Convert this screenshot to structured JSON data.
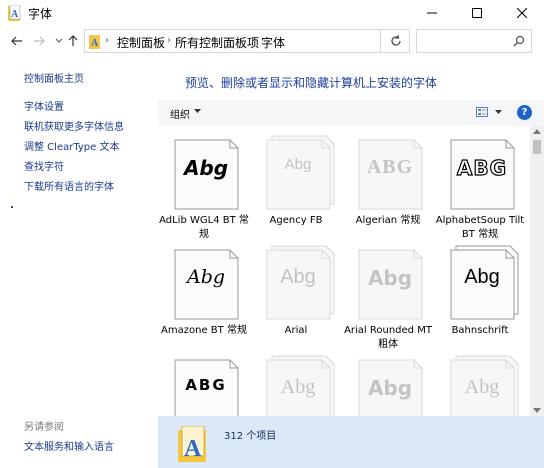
{
  "window": {
    "title": "字体",
    "controls": {
      "minimize_icon": "minimize-icon",
      "maximize_icon": "maximize-icon",
      "close_icon": "close-icon"
    }
  },
  "address_bar": {
    "breadcrumbs": [
      "控制面板",
      "所有控制面板项",
      "字体"
    ],
    "search_placeholder": ""
  },
  "left_pane": {
    "home": "控制面板主页",
    "links": [
      "字体设置",
      "联机获取更多字体信息",
      "调整 ClearType 文本",
      "查找字符",
      "下载所有语言的字体"
    ],
    "see_also_heading": "另请参阅",
    "see_also_links": [
      "文本服务和输入语言"
    ]
  },
  "main": {
    "title": "预览、删除或者显示和隐藏计算机上安装的字体",
    "toolbar": {
      "organize": "组织",
      "help": "?"
    },
    "fonts": [
      {
        "name": "AdLib WGL4 BT 常规",
        "sample": "Abg",
        "style": "bold-italic",
        "hidden": false,
        "stacked": false
      },
      {
        "name": "Agency FB",
        "sample": "Abg",
        "style": "condensed",
        "hidden": true,
        "stacked": true
      },
      {
        "name": "Algerian 常规",
        "sample": "ABG",
        "style": "serif-caps",
        "hidden": true,
        "stacked": false
      },
      {
        "name": "AlphabetSoup Tilt BT 常规",
        "sample": "ABG",
        "style": "outline-caps",
        "hidden": false,
        "stacked": false
      },
      {
        "name": "Amazone BT 常规",
        "sample": "Abg",
        "style": "script",
        "hidden": false,
        "stacked": false
      },
      {
        "name": "Arial",
        "sample": "Abg",
        "style": "sans",
        "hidden": true,
        "stacked": true
      },
      {
        "name": "Arial Rounded MT 粗体",
        "sample": "Abg",
        "style": "rounded-bold",
        "hidden": true,
        "stacked": false
      },
      {
        "name": "Bahnschrift",
        "sample": "Abg",
        "style": "sans",
        "hidden": false,
        "stacked": true
      },
      {
        "name": "",
        "sample": "ABG",
        "style": "wide-caps",
        "hidden": false,
        "stacked": false
      },
      {
        "name": "",
        "sample": "Abg",
        "style": "serif",
        "hidden": true,
        "stacked": true
      },
      {
        "name": "",
        "sample": "Abg",
        "style": "rounded-bold",
        "hidden": true,
        "stacked": false
      },
      {
        "name": "",
        "sample": "Abg",
        "style": "serif",
        "hidden": true,
        "stacked": true
      }
    ]
  },
  "details_pane": {
    "count_text": "312 个项目"
  },
  "colors": {
    "link": "#1a3a8a",
    "title": "#1e3f9a",
    "details_bg": "#dbe8f7",
    "help_blue": "#1e63c8"
  }
}
